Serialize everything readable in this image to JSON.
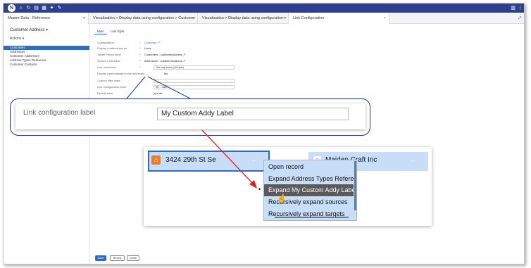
{
  "topbar": {
    "logo_letter": "N",
    "icons": [
      "home-icon",
      "refresh-icon",
      "document-icon",
      "grid-icon",
      "pin-icon",
      "edit-icon"
    ],
    "right_icons": [
      "panel-icon",
      "more-icon"
    ]
  },
  "tabs": [
    {
      "label": "Master Data - Reference"
    },
    {
      "label": "Visualization > Display data using configuration > Customer"
    },
    {
      "label": "Visualization > Display data using configuration >"
    },
    {
      "label": "Link Configuration"
    }
  ],
  "sidebar": {
    "title": "Customer Address",
    "actions_label": "Actions ▾",
    "items": [
      {
        "label": "Customers"
      },
      {
        "label": "Addresses"
      },
      {
        "label": "Customer Addresses"
      },
      {
        "label": "Address Types Reference"
      },
      {
        "label": "Customer Contacts"
      }
    ]
  },
  "subtabs": [
    {
      "label": "Main"
    },
    {
      "label": "Link Style"
    }
  ],
  "form": [
    {
      "label": "Configuration",
      "value": "Customer ↗"
    },
    {
      "label": "Display relationships as",
      "value": "Lines"
    },
    {
      "label": "Target Parent table",
      "value": "Customers - customerAddress ↗"
    },
    {
      "label": "Source Child table",
      "value": "Addresses - customerAddress ↗"
    },
    {
      "label": "Link orientation",
      "value": "One way arrow (Left side)"
    },
    {
      "label": "Display parent/target nodes automatic...",
      "value": "No"
    },
    {
      "label": "Custom filter class",
      "value": ""
    },
    {
      "label": "Link configuration label",
      "value": "My ... label"
    },
    {
      "label": "Default label",
      "value": "[not de..."
    }
  ],
  "buttons": {
    "save": "Save",
    "revert": "Revert",
    "close": "Close"
  },
  "callout": {
    "label": "Link configuration label",
    "value": "My Custom Addy Label"
  },
  "diagram": {
    "node1": "3424 29th St Se",
    "node2": "Maiden Craft Inc",
    "menu": [
      "Open record",
      "Expand Address Types Reference",
      "Expand My Custom Addy Label",
      "Recursively expand sources",
      "Recursively expand targets"
    ]
  },
  "colors": {
    "topbar": "#2d3f8f",
    "accent": "#2f6dc4",
    "callout_border": "#2330a8",
    "arrow": "#e02020"
  }
}
